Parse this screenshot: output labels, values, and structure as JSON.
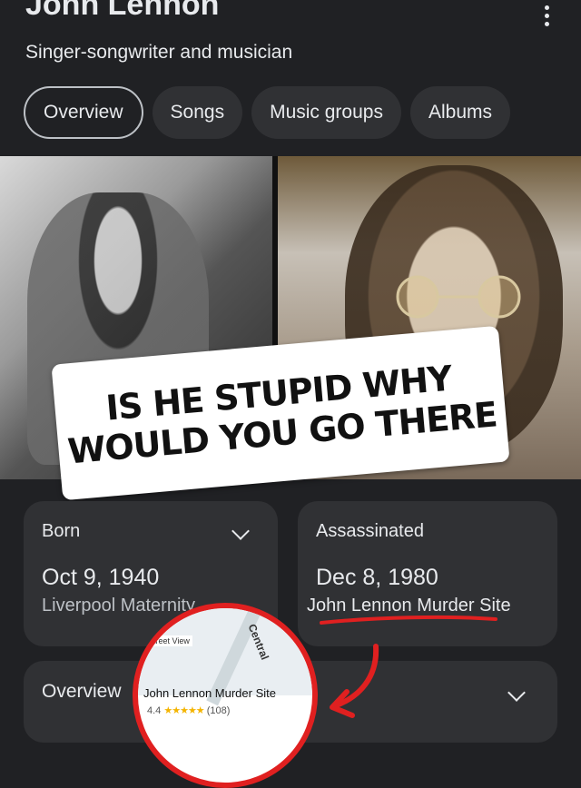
{
  "header": {
    "title": "John Lennon",
    "subtitle": "Singer-songwriter and musician"
  },
  "tabs": [
    {
      "label": "Overview",
      "active": true
    },
    {
      "label": "Songs"
    },
    {
      "label": "Music groups"
    },
    {
      "label": "Albums"
    }
  ],
  "caption": {
    "line1": "IS HE STUPID WHY",
    "line2": "WOULD YOU GO THERE"
  },
  "born_card": {
    "label": "Born",
    "date": "Oct 9, 1940",
    "place": "Liverpool Maternity"
  },
  "death_card": {
    "label": "Assassinated",
    "date": "Dec 8, 1980",
    "place": "John Lennon Murder Site"
  },
  "overview_card": {
    "label": "Overview"
  },
  "map_popup": {
    "street_view": "Street View",
    "road_label": "Central",
    "place_name": "John Lennon Murder Site",
    "rating": "4.4",
    "stars": "★★★★★",
    "review_count": "(108)"
  },
  "colors": {
    "background": "#202124",
    "card": "#303134",
    "annotation_red": "#e02020",
    "star": "#f4b400"
  }
}
